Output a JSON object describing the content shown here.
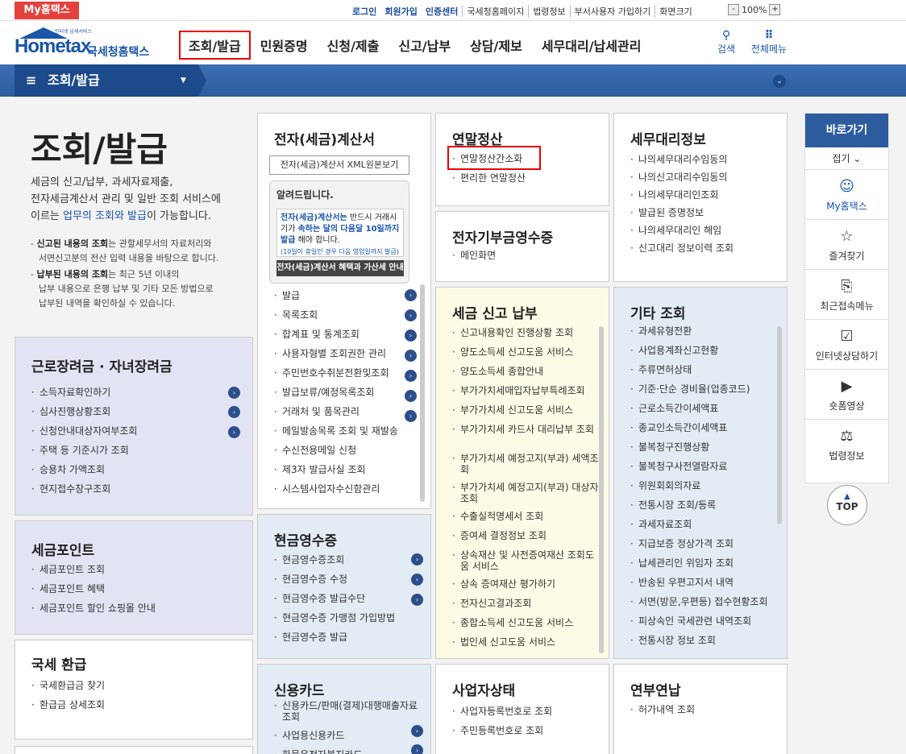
{
  "topbar": {
    "my_hometax": "My홈택스",
    "links": [
      "로그인",
      "회원가입",
      "인증센터",
      "국세청홈페이지",
      "법령정보",
      "부서사용자 가입하기",
      "화면크기"
    ],
    "zoom": "100%",
    "zoom_minus": "-",
    "zoom_plus": "+"
  },
  "header": {
    "logo_tagline": "인터넷 납세서비스",
    "logo_text": "Hometax",
    "logo_kr": "국세청홈택스",
    "menu": [
      "조회/발급",
      "민원증명",
      "신청/제출",
      "신고/납부",
      "상담/제보",
      "세무대리/납세관리"
    ],
    "search_label": "검색",
    "allmenu_label": "전체메뉴"
  },
  "subnav": {
    "title": "조회/발급"
  },
  "hero": {
    "title": "조회/발급",
    "desc1": "세금의 신고/납부, 과세자료제출,",
    "desc2": "전자세금계산서 관리 및 일반 조회 서비스에",
    "desc3a": "이르는 ",
    "desc3b": "업무의 조회와 발급",
    "desc3c": "이 가능합니다.",
    "note1a": "신고된 내용의 조회",
    "note1b": "는 관할세무서의 자료처리와",
    "note1c": "서면신고분의 전산 입력 내용을 바탕으로 합니다.",
    "note2a": "납부된 내용의 조회",
    "note2b": "는 최근 5년 이내의",
    "note2c": "납부 내용으로 은행 납부 및 기타 모든 방법으로",
    "note2d": "납부된 내역을 확인하실 수 있습니다."
  },
  "panels": {
    "labor": {
      "title": "근로장려금 · 자녀장려금",
      "items": [
        "소득자료확인하기",
        "심사진행상황조회",
        "신청안내대상자여부조회",
        "주택 등 기준시가 조회",
        "승용차 가액조회",
        "현지접수창구조회"
      ]
    },
    "point": {
      "title": "세금포인트",
      "items": [
        "세금포인트 조회",
        "세금포인트 혜택",
        "세금포인트 할인 쇼핑몰 안내"
      ]
    },
    "refund": {
      "title": "국세 환급",
      "items": [
        "국세환급금 찾기",
        "환급금 상세조회"
      ]
    },
    "einvoice": {
      "title": "전자(세금)계산서",
      "xml_button": "전자(세금)계산서 XML원본보기",
      "notice_title": "알려드립니다.",
      "notice1": "전자(세금)계산서는",
      "notice2": " 반드시 거래시기가 ",
      "notice3": "속하는 달의 다음달 10일까지 발급",
      "notice4": " 해야 합니다.",
      "notice5": "(10일이 휴일인 경우 다음 영업일까지 발급)",
      "notice_btn": "전자(세금)계산서 혜택과 가산세 안내",
      "items": [
        "발급",
        "목록조회",
        "합계표 및 통계조회",
        "사용자형별 조회권한 관리",
        "주민번호수취분전환및조회",
        "발급보류/예정목록조회",
        "거래처 및 품목관리",
        "메일발송목록 조회 및 재발송",
        "수신전용메일 신청",
        "제3자 발급사실 조회",
        "시스템사업자수신함관리"
      ]
    },
    "cash": {
      "title": "현금영수증",
      "items": [
        "현금영수증조회",
        "현금영수증 수정",
        "현금영수증 발급수단",
        "현금영수증 가맹점 가입방법",
        "현금영수증 발급"
      ]
    },
    "card": {
      "title": "신용카드",
      "items": [
        "신용카드/판매(결제)대행매출자료조회",
        "사업용신용카드",
        "화물운전자복지카드"
      ]
    },
    "yearend": {
      "title": "연말정산",
      "items": [
        "연말정산간소화",
        "편리한 연말정산"
      ]
    },
    "donation": {
      "title": "전자기부금영수증",
      "items": [
        "메인화면"
      ]
    },
    "taxreport": {
      "title": "세금 신고 납부",
      "items": [
        "신고내용확인 진행상황 조회",
        "양도소득세 신고도움 서비스",
        "양도소득세 종합안내",
        "부가가치세매입자납부특례조회",
        "부가가치세 신고도움 서비스",
        "부가가치세 카드사 대리납부 조회",
        "부가가치세 예정고지(부과) 세액조회",
        "부가가치세 예정고지(부과) 대상자 조회",
        "수출실적명세서 조회",
        "증여세 결정정보 조회",
        "상속재산 및 사전증여재산 조회도움 서비스",
        "상속 증여재산 평가하기",
        "전자신고결과조회",
        "종합소득세 신고도움 서비스",
        "법인세 신고도움 서비스"
      ]
    },
    "bizstatus": {
      "title": "사업자상태",
      "items": [
        "사업자등록번호로 조회",
        "주민등록번호로 조회"
      ]
    },
    "agent": {
      "title": "세무대리정보",
      "items": [
        "나의세무대리수임동의",
        "나의신고대리수임동의",
        "나의세무대리인조회",
        "발급된 증명정보",
        "나의세무대리인 해임",
        "신고대리 정보이력 조회"
      ]
    },
    "other": {
      "title": "기타 조회",
      "items": [
        "과세유형전환",
        "사업용계좌신고현황",
        "주류면허상태",
        "기준·단순 경비율(업종코드)",
        "근로소득간이세액표",
        "종교인소득간이세액표",
        "불복청구진행상황",
        "불복청구사전열람자료",
        "위원회회의자료",
        "전통시장 조회/등록",
        "과세자료조회",
        "지급보증 정상가격 조회",
        "납세관리인 위임자 조회",
        "반송된 우편고지서 내역",
        "서면(방문,우편등) 접수현황조회",
        "피상속인 국세관련 내역조회",
        "전통시장 정보 조회"
      ]
    },
    "installment": {
      "title": "연부연납",
      "items": [
        "허가내역 조회"
      ]
    }
  },
  "sidebar": {
    "title": "바로가기",
    "fold": "접기",
    "items": [
      "My홈택스",
      "즐겨찾기",
      "최근접속메뉴",
      "인터넷상담하기",
      "숏폼영상",
      "법령정보"
    ],
    "top": "TOP"
  }
}
